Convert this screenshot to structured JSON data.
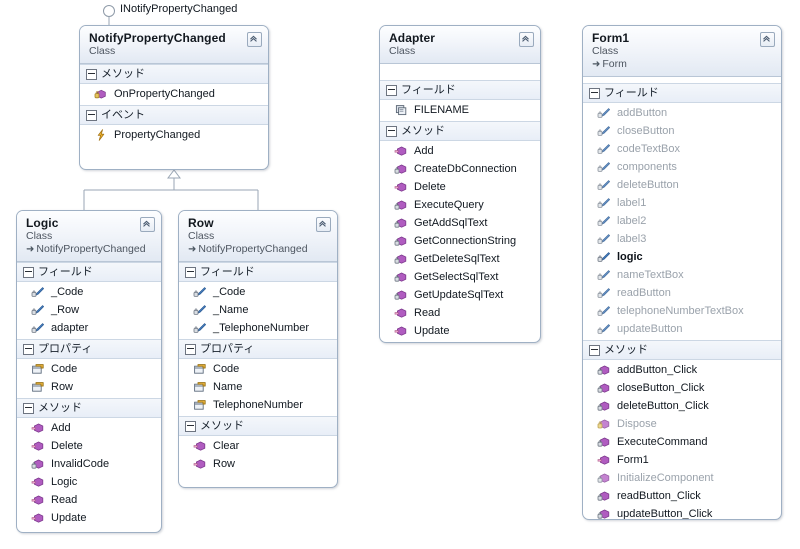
{
  "diagram": {
    "title": "Class Diagram",
    "canvas_background": "#ffffff",
    "interface_lollipop": {
      "label": "INotifyPropertyChanged",
      "icon": "interface-lollipop-icon"
    },
    "relationships": [
      {
        "type": "inheritance",
        "from": "Logic",
        "to": "NotifyPropertyChanged"
      },
      {
        "type": "inheritance",
        "from": "Row",
        "to": "NotifyPropertyChanged"
      },
      {
        "type": "implements",
        "from": "NotifyPropertyChanged",
        "to": "INotifyPropertyChanged"
      }
    ],
    "section_labels": {
      "fields": "フィールド",
      "properties": "プロパティ",
      "methods": "メソッド",
      "events": "イベント"
    },
    "kind_label": "Class",
    "colors": {
      "border": "#9fb0c4",
      "header_gradient_top": "#fdfeff",
      "header_gradient_bottom": "#e2e9f3",
      "section_band": "#e8eef7",
      "field_icon": "#4a7ebb",
      "property_icon": "#d6a327",
      "method_icon": "#a64ca6",
      "event_icon": "#e8a317",
      "constant_icon": "#7a8a9a",
      "dim_text": "#9aa2ab"
    }
  },
  "classes": [
    {
      "id": "notifypropertychanged",
      "name": "NotifyPropertyChanged",
      "kind": "Class",
      "base": null,
      "sections": [
        {
          "key": "methods",
          "label": "メソッド",
          "members": [
            {
              "name": "OnPropertyChanged",
              "icon": "method-protected-icon",
              "dim": false,
              "bold": false
            }
          ]
        },
        {
          "key": "events",
          "label": "イベント",
          "members": [
            {
              "name": "PropertyChanged",
              "icon": "event-icon",
              "dim": false,
              "bold": false
            }
          ]
        }
      ]
    },
    {
      "id": "logic",
      "name": "Logic",
      "kind": "Class",
      "base": "NotifyPropertyChanged",
      "sections": [
        {
          "key": "fields",
          "label": "フィールド",
          "members": [
            {
              "name": "_Code",
              "icon": "field-private-icon",
              "dim": false,
              "bold": false
            },
            {
              "name": "_Row",
              "icon": "field-private-icon",
              "dim": false,
              "bold": false
            },
            {
              "name": "adapter",
              "icon": "field-private-icon",
              "dim": false,
              "bold": false
            }
          ]
        },
        {
          "key": "properties",
          "label": "プロパティ",
          "members": [
            {
              "name": "Code",
              "icon": "property-icon",
              "dim": false,
              "bold": false
            },
            {
              "name": "Row",
              "icon": "property-icon",
              "dim": false,
              "bold": false
            }
          ]
        },
        {
          "key": "methods",
          "label": "メソッド",
          "members": [
            {
              "name": "Add",
              "icon": "method-icon",
              "dim": false,
              "bold": false
            },
            {
              "name": "Delete",
              "icon": "method-icon",
              "dim": false,
              "bold": false
            },
            {
              "name": "InvalidCode",
              "icon": "method-private-icon",
              "dim": false,
              "bold": false
            },
            {
              "name": "Logic",
              "icon": "method-icon",
              "dim": false,
              "bold": false
            },
            {
              "name": "Read",
              "icon": "method-icon",
              "dim": false,
              "bold": false
            },
            {
              "name": "Update",
              "icon": "method-icon",
              "dim": false,
              "bold": false
            }
          ]
        }
      ]
    },
    {
      "id": "row",
      "name": "Row",
      "kind": "Class",
      "base": "NotifyPropertyChanged",
      "sections": [
        {
          "key": "fields",
          "label": "フィールド",
          "members": [
            {
              "name": "_Code",
              "icon": "field-private-icon",
              "dim": false,
              "bold": false
            },
            {
              "name": "_Name",
              "icon": "field-private-icon",
              "dim": false,
              "bold": false
            },
            {
              "name": "_TelephoneNumber",
              "icon": "field-private-icon",
              "dim": false,
              "bold": false
            }
          ]
        },
        {
          "key": "properties",
          "label": "プロパティ",
          "members": [
            {
              "name": "Code",
              "icon": "property-icon",
              "dim": false,
              "bold": false
            },
            {
              "name": "Name",
              "icon": "property-icon",
              "dim": false,
              "bold": false
            },
            {
              "name": "TelephoneNumber",
              "icon": "property-icon",
              "dim": false,
              "bold": false
            }
          ]
        },
        {
          "key": "methods",
          "label": "メソッド",
          "members": [
            {
              "name": "Clear",
              "icon": "method-icon",
              "dim": false,
              "bold": false
            },
            {
              "name": "Row",
              "icon": "method-icon",
              "dim": false,
              "bold": false
            }
          ]
        }
      ]
    },
    {
      "id": "adapter",
      "name": "Adapter",
      "kind": "Class",
      "base": null,
      "sections": [
        {
          "key": "fields",
          "label": "フィールド",
          "members": [
            {
              "name": "FILENAME",
              "icon": "constant-icon",
              "dim": false,
              "bold": false
            }
          ]
        },
        {
          "key": "methods",
          "label": "メソッド",
          "members": [
            {
              "name": "Add",
              "icon": "method-icon",
              "dim": false,
              "bold": false
            },
            {
              "name": "CreateDbConnection",
              "icon": "method-private-icon",
              "dim": false,
              "bold": false
            },
            {
              "name": "Delete",
              "icon": "method-icon",
              "dim": false,
              "bold": false
            },
            {
              "name": "ExecuteQuery",
              "icon": "method-private-icon",
              "dim": false,
              "bold": false
            },
            {
              "name": "GetAddSqlText",
              "icon": "method-private-icon",
              "dim": false,
              "bold": false
            },
            {
              "name": "GetConnectionString",
              "icon": "method-private-icon",
              "dim": false,
              "bold": false
            },
            {
              "name": "GetDeleteSqlText",
              "icon": "method-private-icon",
              "dim": false,
              "bold": false
            },
            {
              "name": "GetSelectSqlText",
              "icon": "method-private-icon",
              "dim": false,
              "bold": false
            },
            {
              "name": "GetUpdateSqlText",
              "icon": "method-private-icon",
              "dim": false,
              "bold": false
            },
            {
              "name": "Read",
              "icon": "method-icon",
              "dim": false,
              "bold": false
            },
            {
              "name": "Update",
              "icon": "method-icon",
              "dim": false,
              "bold": false
            }
          ]
        }
      ]
    },
    {
      "id": "form1",
      "name": "Form1",
      "kind": "Class",
      "base": "Form",
      "sections": [
        {
          "key": "fields",
          "label": "フィールド",
          "members": [
            {
              "name": "addButton",
              "icon": "field-private-icon",
              "dim": true,
              "bold": false
            },
            {
              "name": "closeButton",
              "icon": "field-private-icon",
              "dim": true,
              "bold": false
            },
            {
              "name": "codeTextBox",
              "icon": "field-private-icon",
              "dim": true,
              "bold": false
            },
            {
              "name": "components",
              "icon": "field-private-icon",
              "dim": true,
              "bold": false
            },
            {
              "name": "deleteButton",
              "icon": "field-private-icon",
              "dim": true,
              "bold": false
            },
            {
              "name": "label1",
              "icon": "field-private-icon",
              "dim": true,
              "bold": false
            },
            {
              "name": "label2",
              "icon": "field-private-icon",
              "dim": true,
              "bold": false
            },
            {
              "name": "label3",
              "icon": "field-private-icon",
              "dim": true,
              "bold": false
            },
            {
              "name": "logic",
              "icon": "field-private-icon",
              "dim": false,
              "bold": true
            },
            {
              "name": "nameTextBox",
              "icon": "field-private-icon",
              "dim": true,
              "bold": false
            },
            {
              "name": "readButton",
              "icon": "field-private-icon",
              "dim": true,
              "bold": false
            },
            {
              "name": "telephoneNumberTextBox",
              "icon": "field-private-icon",
              "dim": true,
              "bold": false
            },
            {
              "name": "updateButton",
              "icon": "field-private-icon",
              "dim": true,
              "bold": false
            }
          ]
        },
        {
          "key": "methods",
          "label": "メソッド",
          "members": [
            {
              "name": "addButton_Click",
              "icon": "method-private-icon",
              "dim": false,
              "bold": false
            },
            {
              "name": "closeButton_Click",
              "icon": "method-private-icon",
              "dim": false,
              "bold": false
            },
            {
              "name": "deleteButton_Click",
              "icon": "method-private-icon",
              "dim": false,
              "bold": false
            },
            {
              "name": "Dispose",
              "icon": "method-protected-icon",
              "dim": true,
              "bold": false
            },
            {
              "name": "ExecuteCommand",
              "icon": "method-private-icon",
              "dim": false,
              "bold": false
            },
            {
              "name": "Form1",
              "icon": "method-icon",
              "dim": false,
              "bold": false
            },
            {
              "name": "InitializeComponent",
              "icon": "method-private-icon",
              "dim": true,
              "bold": false
            },
            {
              "name": "readButton_Click",
              "icon": "method-private-icon",
              "dim": false,
              "bold": false
            },
            {
              "name": "updateButton_Click",
              "icon": "method-private-icon",
              "dim": false,
              "bold": false
            }
          ]
        }
      ]
    }
  ]
}
